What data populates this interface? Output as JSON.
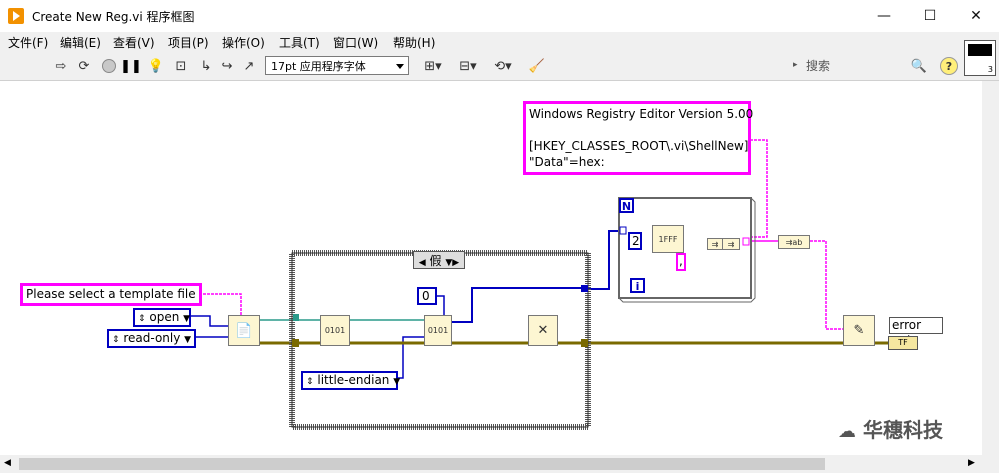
{
  "window": {
    "title": "Create New Reg.vi 程序框图",
    "controls": {
      "minimize": "—",
      "maximize": "☐",
      "close": "✕"
    }
  },
  "menu": {
    "items": [
      "文件(F)",
      "编辑(E)",
      "查看(V)",
      "项目(P)",
      "操作(O)",
      "工具(T)",
      "窗口(W)",
      "帮助(H)"
    ]
  },
  "toolbar": {
    "font": "17pt 应用程序字体",
    "search_placeholder": "搜索",
    "search_prefix": "▸",
    "help": "?",
    "connector_num": "3"
  },
  "diagram": {
    "template_prompt": "Please select a template file",
    "open_ring": "open",
    "readonly_ring": "read-only",
    "case_selector": "假",
    "offset_const": "0",
    "endian_ring": "little-endian",
    "registry_text_line1": "Windows Registry Editor Version 5.00",
    "registry_text_line2": "[HKEY_CLASSES_ROOT\\.vi\\ShellNew]",
    "registry_text_line3": "\"Data\"=hex:",
    "loop_count": "N",
    "loop_index": "i",
    "width_const": "2",
    "comma_const": ",",
    "error_out_label": "error out",
    "hex_glyph": "1FFF",
    "tf_glyph": "TF"
  },
  "watermark": "华穗科技"
}
